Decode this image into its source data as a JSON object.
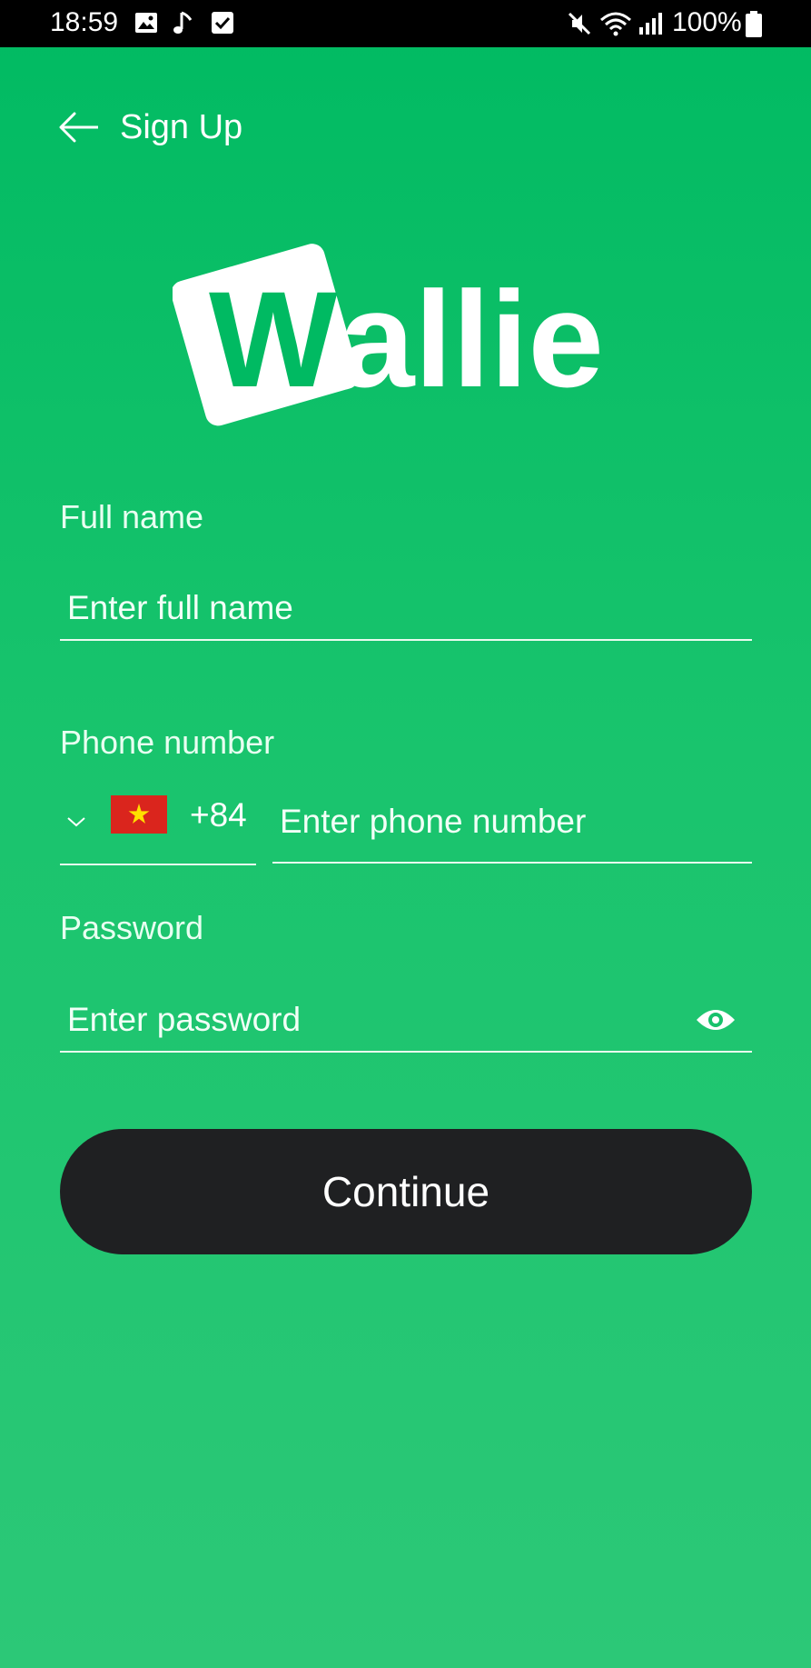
{
  "status_bar": {
    "time": "18:59",
    "battery": "100%",
    "left_icons": [
      "image-icon",
      "music-note-icon",
      "checkbox-icon"
    ],
    "right_icons": [
      "mute-icon",
      "wifi-icon",
      "signal-icon",
      "battery-icon"
    ]
  },
  "header": {
    "back_icon": "arrow-left-icon",
    "title": "Sign Up"
  },
  "logo": {
    "text": "Wallie",
    "color": "#ffffff",
    "tile_letter_color": "#00ba62"
  },
  "form": {
    "full_name": {
      "label": "Full name",
      "placeholder": "Enter full name",
      "value": ""
    },
    "phone": {
      "label": "Phone number",
      "country_flag": "vietnam-flag-icon",
      "dial_code": "+84",
      "placeholder": "Enter phone number",
      "value": ""
    },
    "password": {
      "label": "Password",
      "placeholder": "Enter password",
      "value": "",
      "toggle_icon": "eye-icon"
    },
    "submit_label": "Continue"
  },
  "colors": {
    "background_top": "#00ba62",
    "background_bottom": "#2cc877",
    "button": "#1f2022",
    "flag_red": "#da251d",
    "flag_star": "#ffdf00"
  }
}
